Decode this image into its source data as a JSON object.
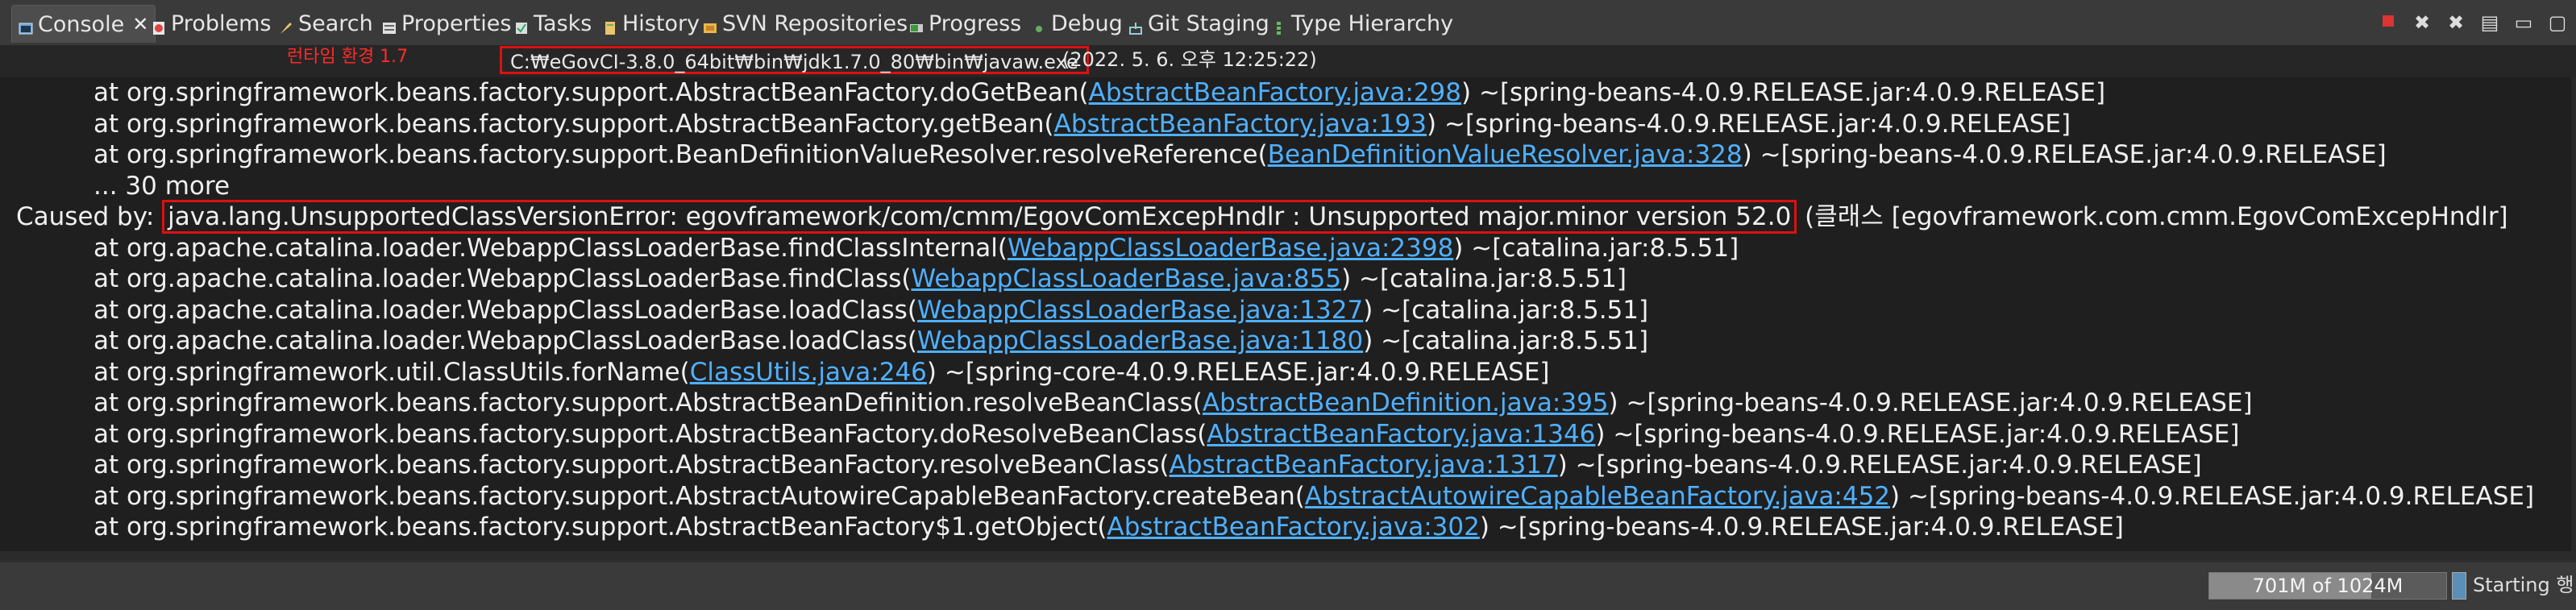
{
  "tabs": [
    {
      "label": "Console",
      "icon": "console-icon",
      "active": true
    },
    {
      "label": "Problems",
      "icon": "problems-icon"
    },
    {
      "label": "Search",
      "icon": "search-icon"
    },
    {
      "label": "Properties",
      "icon": "properties-icon"
    },
    {
      "label": "Tasks",
      "icon": "tasks-icon"
    },
    {
      "label": "History",
      "icon": "history-icon"
    },
    {
      "label": "SVN Repositories",
      "icon": "svn-icon"
    },
    {
      "label": "Progress",
      "icon": "progress-icon"
    },
    {
      "label": "Debug",
      "icon": "debug-icon"
    },
    {
      "label": "Git Staging",
      "icon": "git-staging-icon"
    },
    {
      "label": "Type Hierarchy",
      "icon": "type-hierarchy-icon"
    }
  ],
  "runtime": {
    "label": "런타임 환경 1.7",
    "path": "C:₩eGovCI-3.8.0_64bit₩bin₩jdk1.7.0_80₩bin₩javaw.exe",
    "time": "(2022. 5. 6. 오후 12:25:22)"
  },
  "console": {
    "lines": [
      {
        "t": "at org.springframework.beans.factory.support.AbstractBeanFactory.doGetBean(",
        "l": "AbstractBeanFactory.java:298",
        "s": ") ~[spring-beans-4.0.9.RELEASE.jar:4.0.9.RELEASE]"
      },
      {
        "t": "at org.springframework.beans.factory.support.AbstractBeanFactory.getBean(",
        "l": "AbstractBeanFactory.java:193",
        "s": ") ~[spring-beans-4.0.9.RELEASE.jar:4.0.9.RELEASE]"
      },
      {
        "t": "at org.springframework.beans.factory.support.BeanDefinitionValueResolver.resolveReference(",
        "l": "BeanDefinitionValueResolver.java:328",
        "s": ") ~[spring-beans-4.0.9.RELEASE.jar:4.0.9.RELEASE]"
      },
      {
        "t": "... 30 more",
        "l": "",
        "s": ""
      },
      {
        "t": "at org.apache.catalina.loader.WebappClassLoaderBase.findClassInternal(",
        "l": "WebappClassLoaderBase.java:2398",
        "s": ") ~[catalina.jar:8.5.51]"
      },
      {
        "t": "at org.apache.catalina.loader.WebappClassLoaderBase.findClass(",
        "l": "WebappClassLoaderBase.java:855",
        "s": ") ~[catalina.jar:8.5.51]"
      },
      {
        "t": "at org.apache.catalina.loader.WebappClassLoaderBase.loadClass(",
        "l": "WebappClassLoaderBase.java:1327",
        "s": ") ~[catalina.jar:8.5.51]"
      },
      {
        "t": "at org.apache.catalina.loader.WebappClassLoaderBase.loadClass(",
        "l": "WebappClassLoaderBase.java:1180",
        "s": ") ~[catalina.jar:8.5.51]"
      },
      {
        "t": "at org.springframework.util.ClassUtils.forName(",
        "l": "ClassUtils.java:246",
        "s": ") ~[spring-core-4.0.9.RELEASE.jar:4.0.9.RELEASE]"
      },
      {
        "t": "at org.springframework.beans.factory.support.AbstractBeanDefinition.resolveBeanClass(",
        "l": "AbstractBeanDefinition.java:395",
        "s": ") ~[spring-beans-4.0.9.RELEASE.jar:4.0.9.RELEASE]"
      },
      {
        "t": "at org.springframework.beans.factory.support.AbstractBeanFactory.doResolveBeanClass(",
        "l": "AbstractBeanFactory.java:1346",
        "s": ") ~[spring-beans-4.0.9.RELEASE.jar:4.0.9.RELEASE]"
      },
      {
        "t": "at org.springframework.beans.factory.support.AbstractBeanFactory.resolveBeanClass(",
        "l": "AbstractBeanFactory.java:1317",
        "s": ") ~[spring-beans-4.0.9.RELEASE.jar:4.0.9.RELEASE]"
      },
      {
        "t": "at org.springframework.beans.factory.support.AbstractAutowireCapableBeanFactory.createBean(",
        "l": "AbstractAutowireCapableBeanFactory.java:452",
        "s": ") ~[spring-beans-4.0.9.RELEASE.jar:4.0.9.RELEASE]"
      },
      {
        "t": "at org.springframework.beans.factory.support.AbstractBeanFactory$1.getObject(",
        "l": "AbstractBeanFactory.java:302",
        "s": ") ~[spring-beans-4.0.9.RELEASE.jar:4.0.9.RELEASE]"
      }
    ],
    "caused": {
      "prefix": "Caused by: ",
      "error": "java.lang.UnsupportedClassVersionError: egovframework/com/cmm/EgovComExcepHndlr : Unsupported major.minor version 52.0",
      "suffix": " (클래스 [egovframework.com.cmm.EgovComExcepHndlr]"
    }
  },
  "status": {
    "heap": "701M of 1024M",
    "heap_fraction": 0.685,
    "starting": "Starting 행"
  },
  "colors": {
    "link": "#4fb0ff",
    "highlight": "#dd1111",
    "text": "#f0f0f0",
    "background": "#1f1f1f"
  }
}
